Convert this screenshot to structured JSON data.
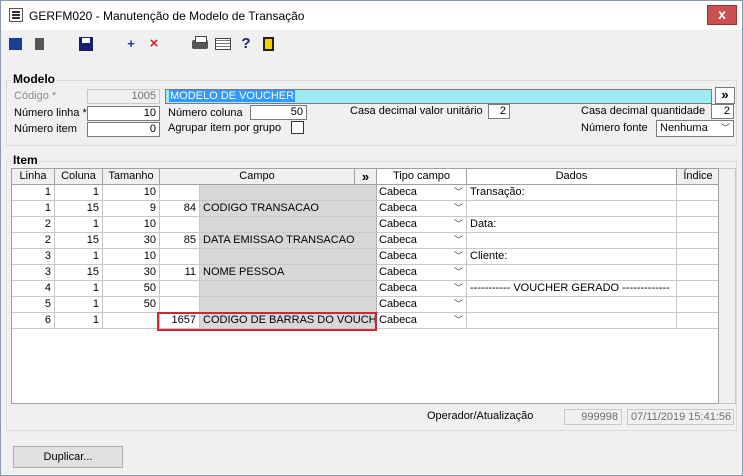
{
  "window": {
    "title": "GERFM020 - Manutenção de Modelo de Transação",
    "close_label": "x"
  },
  "toolbar": {
    "add_symbol": "+",
    "delete_symbol": "×",
    "help_symbol": "?"
  },
  "modelo": {
    "section_label": "Modelo",
    "codigo_label": "Código *",
    "codigo_value": "1005",
    "descricao_value": "MODELO DE VOUCHER",
    "expand_label": "»",
    "numero_linha_label": "Número linha *",
    "numero_linha_value": "10",
    "numero_coluna_label": "Número coluna",
    "numero_coluna_value": "50",
    "casa_unitario_label": "Casa decimal valor unitário",
    "casa_unitario_value": "2",
    "casa_quantidade_label": "Casa decimal quantidade",
    "casa_quantidade_value": "2",
    "numero_item_label": "Número item",
    "numero_item_value": "0",
    "agrupar_label": "Agrupar item por grupo",
    "numero_fonte_label": "Número fonte",
    "numero_fonte_value": "Nenhuma"
  },
  "item": {
    "section_label": "Item",
    "columns": {
      "linha": "Linha",
      "coluna": "Coluna",
      "tamanho": "Tamanho",
      "campo": "Campo",
      "campo_expand": "»",
      "tipo": "Tipo campo",
      "dados": "Dados",
      "indice": "Índice"
    },
    "rows": [
      {
        "linha": "1",
        "coluna": "1",
        "tamanho": "10",
        "cod": "",
        "campo": "",
        "tipo": "Cabeca",
        "dados": "Transação:"
      },
      {
        "linha": "1",
        "coluna": "15",
        "tamanho": "9",
        "cod": "84",
        "campo": "CODIGO TRANSACAO",
        "tipo": "Cabeca",
        "dados": ""
      },
      {
        "linha": "2",
        "coluna": "1",
        "tamanho": "10",
        "cod": "",
        "campo": "",
        "tipo": "Cabeca",
        "dados": "Data:"
      },
      {
        "linha": "2",
        "coluna": "15",
        "tamanho": "30",
        "cod": "85",
        "campo": "DATA EMISSAO TRANSACAO",
        "tipo": "Cabeca",
        "dados": ""
      },
      {
        "linha": "3",
        "coluna": "1",
        "tamanho": "10",
        "cod": "",
        "campo": "",
        "tipo": "Cabeca",
        "dados": "Cliente:"
      },
      {
        "linha": "3",
        "coluna": "15",
        "tamanho": "30",
        "cod": "11",
        "campo": "NOME PESSOA",
        "tipo": "Cabeca",
        "dados": ""
      },
      {
        "linha": "4",
        "coluna": "1",
        "tamanho": "50",
        "cod": "",
        "campo": "",
        "tipo": "Cabeca",
        "dados": "----------- VOUCHER GERADO -------------"
      },
      {
        "linha": "5",
        "coluna": "1",
        "tamanho": "50",
        "cod": "",
        "campo": "",
        "tipo": "Cabeca",
        "dados": ""
      },
      {
        "linha": "6",
        "coluna": "1",
        "tamanho": "",
        "cod": "1657",
        "campo": "CODIGO DE BARRAS DO VOUCHER",
        "tipo": "Cabeca",
        "dados": ""
      }
    ]
  },
  "footer": {
    "operador_label": "Operador/Atualização",
    "operador_value": "999998",
    "data_value": "07/11/2019 15:41:56",
    "duplicar_label": "Duplicar..."
  }
}
